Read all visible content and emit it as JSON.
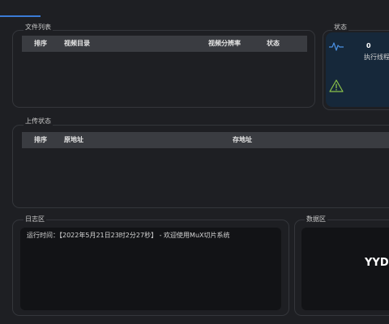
{
  "file_list": {
    "title": "文件列表",
    "columns": [
      "排序",
      "视频目录",
      "视频分辨率",
      "状态"
    ]
  },
  "status": {
    "title": "状态",
    "thread_count": "0",
    "thread_label": "执行线程",
    "icons": [
      "activity-icon",
      "warning-icon"
    ],
    "colors": {
      "activity": "#4a90e2",
      "warning": "#8bc34a",
      "card": "#16283a"
    }
  },
  "upload_status": {
    "title": "上传状态",
    "columns": [
      "排序",
      "原地址",
      "存地址"
    ]
  },
  "log": {
    "title": "日志区",
    "lines": [
      "运行时间：【2022年5月21日23时2分27秒】 - 欢迎使用MuX切片系统"
    ]
  },
  "data_area": {
    "title": "数据区",
    "display_text": "YYDS"
  },
  "theme": {
    "background": "#1e1f23",
    "accent": "#3a7bd5"
  }
}
